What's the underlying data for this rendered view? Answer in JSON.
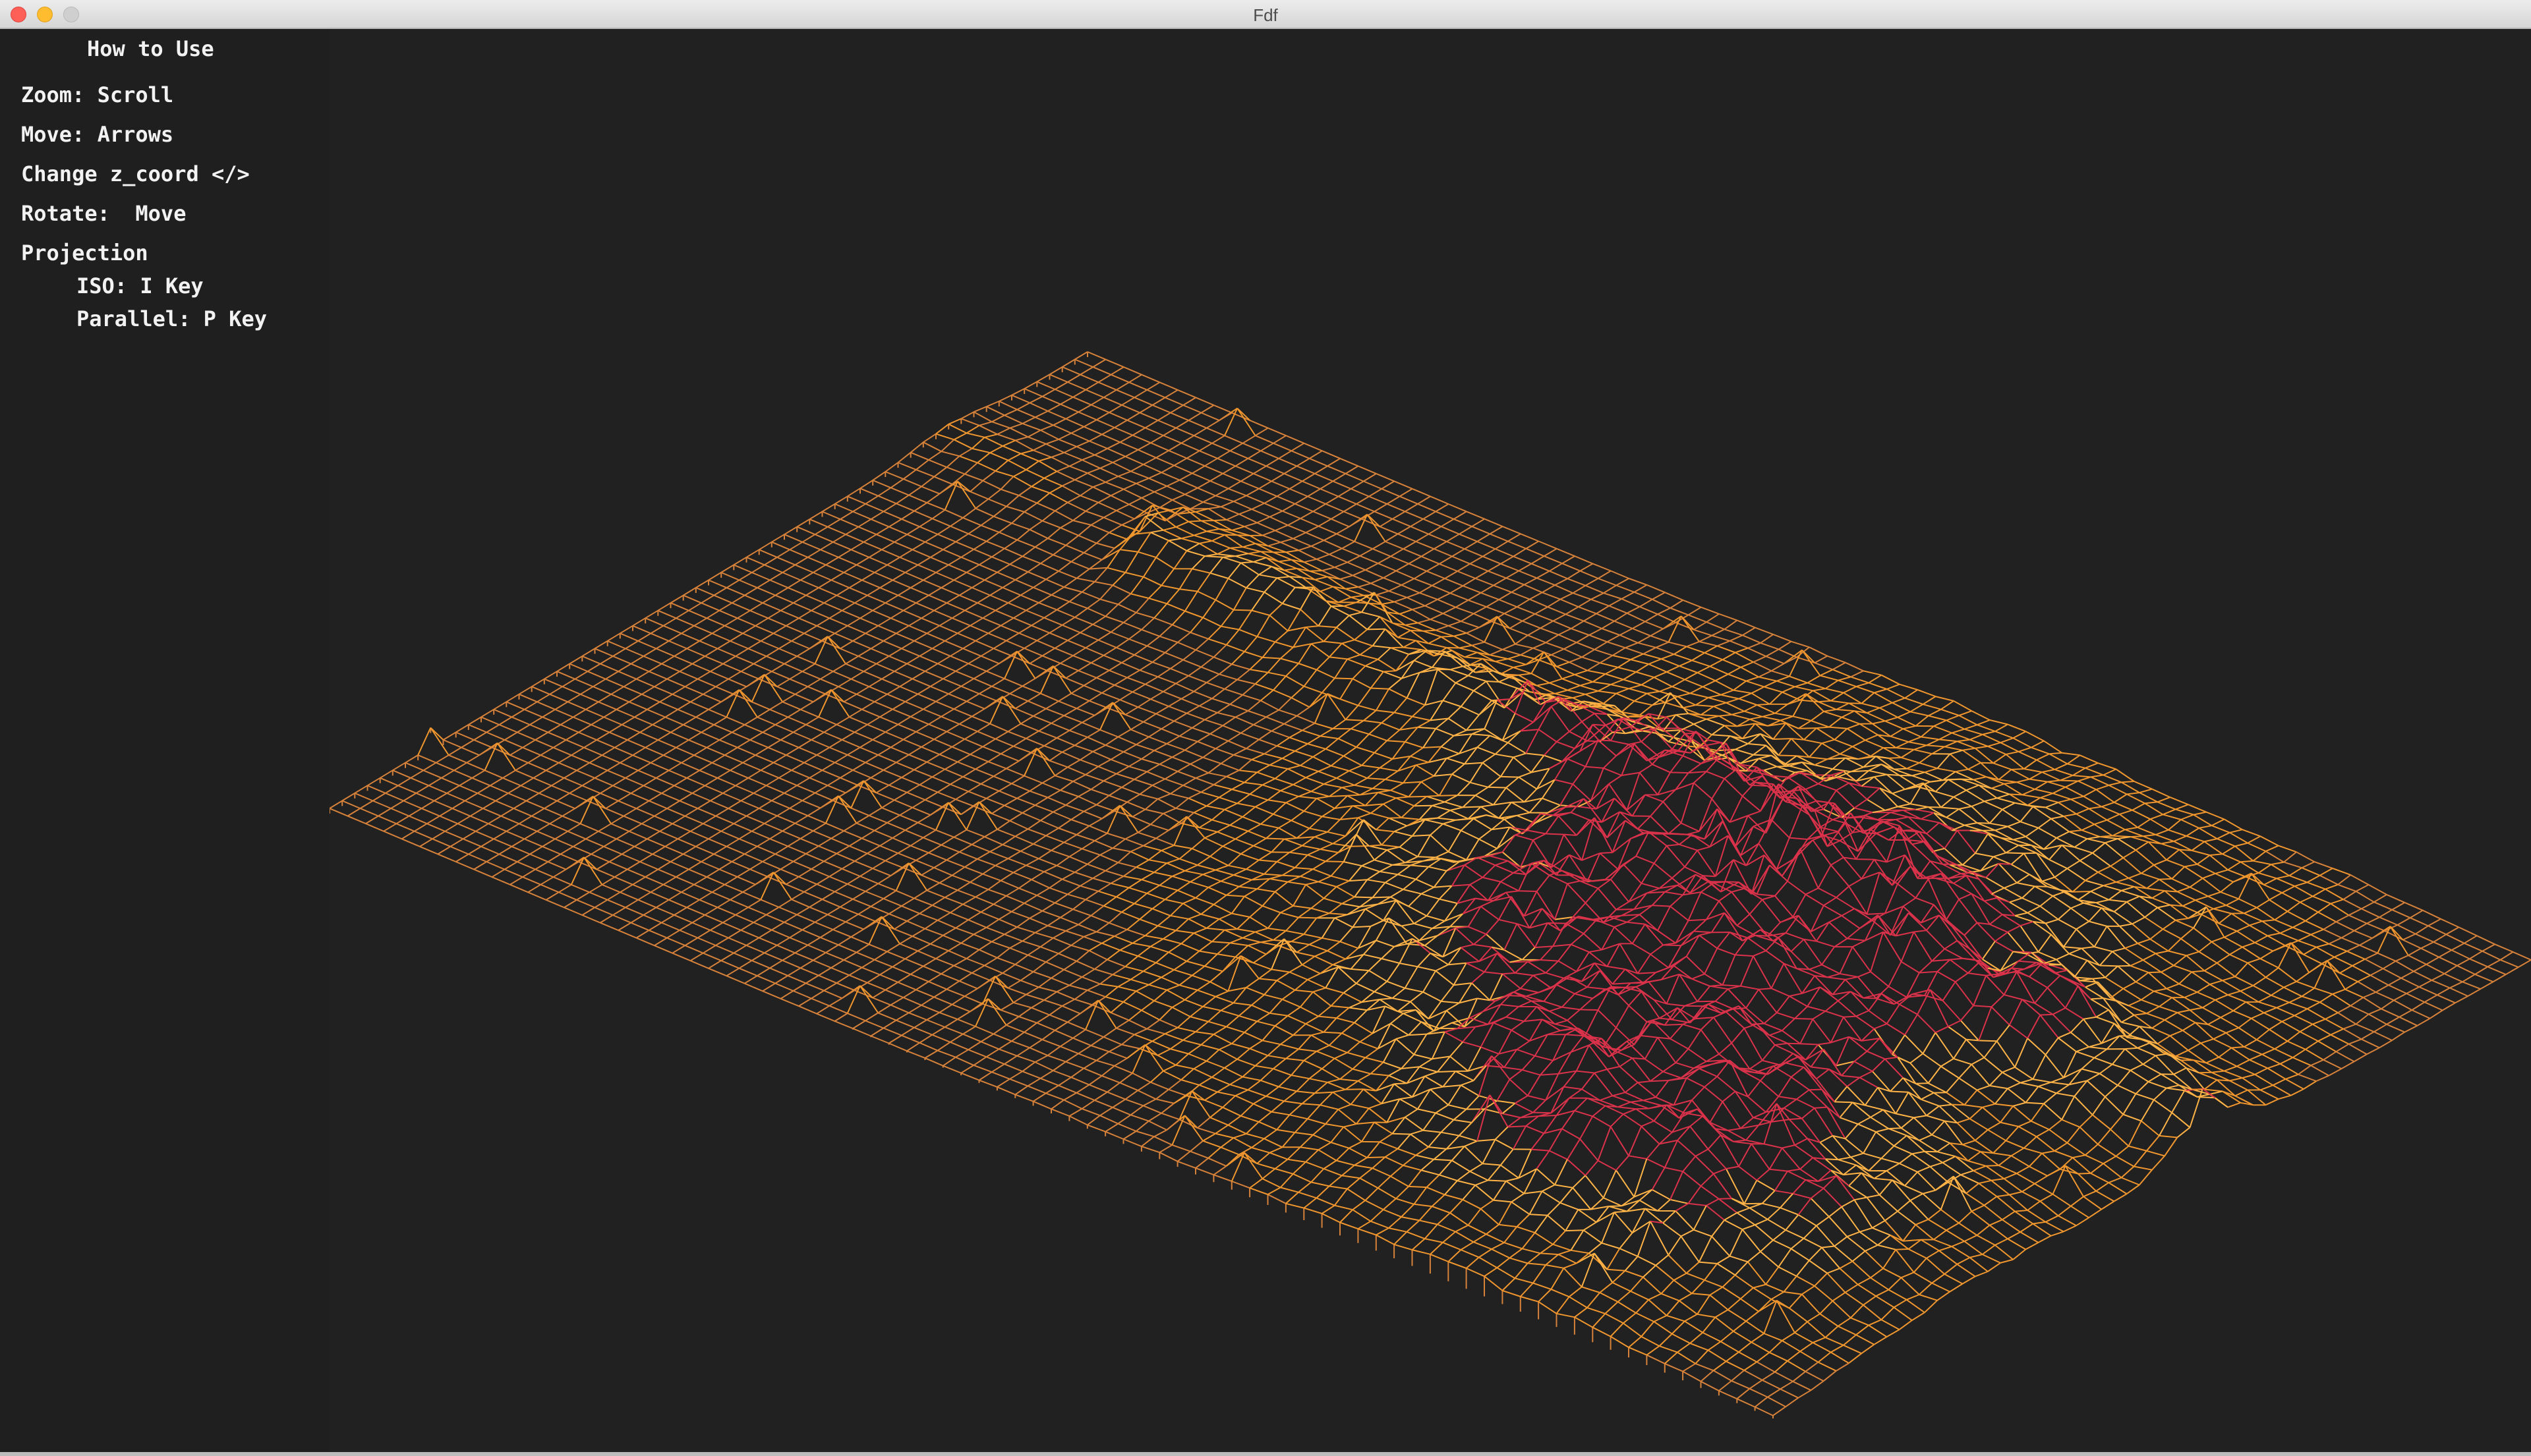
{
  "window": {
    "title": "Fdf"
  },
  "help": {
    "heading": "How to Use",
    "zoom": "Zoom: Scroll",
    "move": "Move: Arrows",
    "z_coord": "Change z_coord </>",
    "rotate": "Rotate:  Move",
    "projection": "Projection",
    "iso": "ISO: I Key",
    "parallel": "Parallel: P Key"
  },
  "colors": {
    "background": "#212121",
    "wire_low": "#d7823a",
    "wire_mid": "#f0962e",
    "wire_high": "#ffb347",
    "wire_peak": "#d9324a"
  }
}
